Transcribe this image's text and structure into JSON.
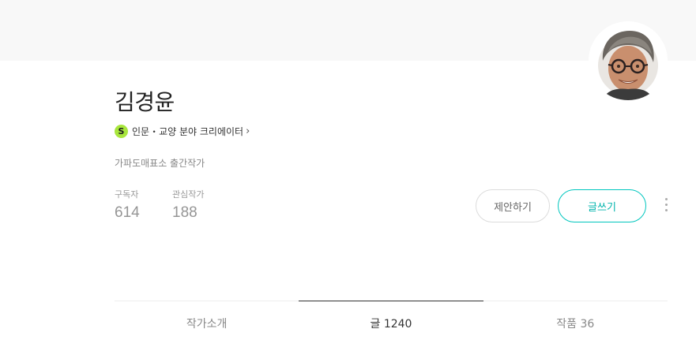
{
  "profile": {
    "name": "김경윤",
    "creator_badge": "S",
    "creator_category": "인문・교양 분야 크리에이터",
    "creator_chevron": "›",
    "description": "가파도매표소 출간작가",
    "avatar_icon": "author-portrait"
  },
  "stats": {
    "subscribers_label": "구독자",
    "subscribers_value": "614",
    "interest_label": "관심작가",
    "interest_value": "188"
  },
  "actions": {
    "propose_label": "제안하기",
    "write_label": "글쓰기",
    "more_icon": "more-vertical"
  },
  "tabs": [
    {
      "label": "작가소개",
      "active": false
    },
    {
      "label": "글 1240",
      "active": true
    },
    {
      "label": "작품 36",
      "active": false
    }
  ],
  "colors": {
    "accent": "#00c6be",
    "badge_green": "#a8e63d",
    "cover_bg": "#f8f8f8"
  }
}
